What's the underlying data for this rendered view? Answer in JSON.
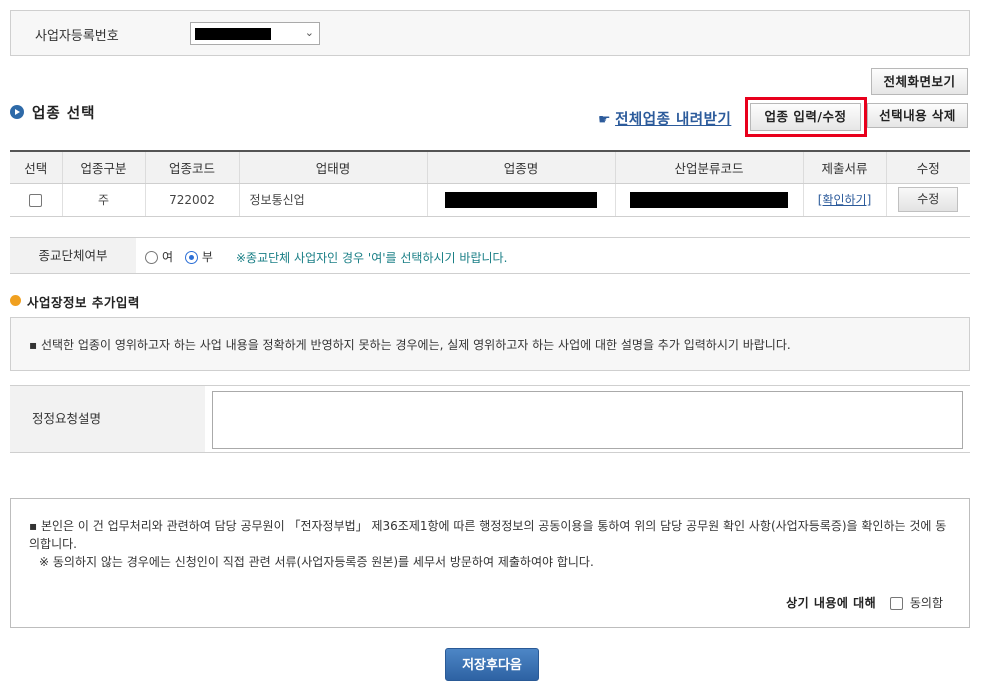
{
  "business": {
    "label": "사업자등록번호",
    "select_value": "",
    "chevron_icon": "chevron-down-icon"
  },
  "toolbar": {
    "full_view_label": "전체화면보기",
    "section_title": "업종 선택",
    "download_link": "전체업종 내려받기",
    "edit_industry_label": "업종 입력/수정",
    "delete_selected_label": "선택내용 삭제"
  },
  "table": {
    "headers": [
      "선택",
      "업종구분",
      "업종코드",
      "업태명",
      "업종명",
      "산업분류코드",
      "제출서류",
      "수정"
    ],
    "rows": [
      {
        "division": "주",
        "code": "722002",
        "business_type": "정보통신업",
        "industry_name": "",
        "classification_code": "",
        "document_link": "[확인하기]",
        "edit_label": "수정"
      }
    ]
  },
  "religious": {
    "label": "종교단체여부",
    "option_yes": "여",
    "option_no": "부",
    "selected": "부",
    "note": "※종교단체 사업자인 경우 '여'를 선택하시기 바랍니다."
  },
  "extra_info": {
    "title": "사업장정보 추가입력",
    "notice": "선택한 업종이 영위하고자 하는 사업 내용을 정확하게 반영하지 못하는 경우에는, 실제 영위하고자 하는 사업에 대한 설명을 추가 입력하시기 바랍니다.",
    "request_label": "정정요청설명",
    "request_value": ""
  },
  "consent": {
    "text": "본인은 이 건 업무처리와 관련하여 담당 공무원이 「전자정부법」 제36조제1항에 따른 행정정보의 공동이용을 통하여 위의 담당 공무원 확인 사항(사업자등록증)을 확인하는 것에 동의합니다.",
    "note": "※  동의하지 않는 경우에는 신청인이 직접 관련 서류(사업자등록증 원본)를 세무서 방문하여 제출하여야 합니다.",
    "question": "상기 내용에 대해",
    "agree_label": "동의함",
    "agreed": false
  },
  "actions": {
    "save_next_label": "저장후다음"
  },
  "colors": {
    "highlight": "#e8001c",
    "link": "#2c5b9b",
    "note": "#1a7f86",
    "primary_button": "#2e62a3"
  }
}
